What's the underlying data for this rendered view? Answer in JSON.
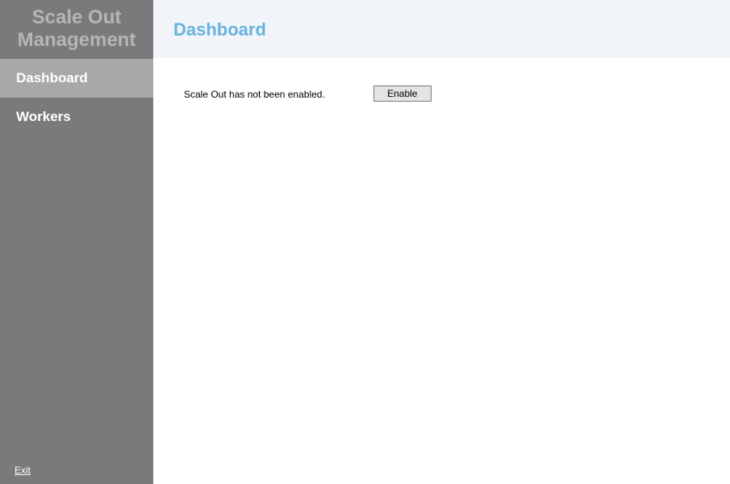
{
  "sidebar": {
    "title_line1": "Scale Out",
    "title_line2": "Management",
    "items": [
      {
        "label": "Dashboard",
        "active": true
      },
      {
        "label": "Workers",
        "active": false
      }
    ],
    "exit_label": "Exit"
  },
  "header": {
    "title": "Dashboard"
  },
  "content": {
    "status_text": "Scale Out has not been enabled.",
    "enable_button_label": "Enable"
  }
}
